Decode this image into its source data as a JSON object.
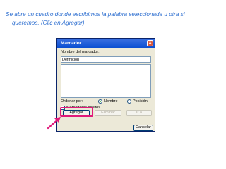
{
  "caption": {
    "line1": "Se abre un cuadro donde escribimos la palabra seleccionada u otra si",
    "line2": "queremos. (Clic en Agregar)"
  },
  "dialog": {
    "title": "Marcador",
    "close_glyph": "×",
    "name_label": "Nombre del marcador:",
    "name_value": "Definición",
    "sort_label": "Ordenar por:",
    "sort_options": [
      {
        "label": "Nombre",
        "selected": true
      },
      {
        "label": "Posición",
        "selected": false
      }
    ],
    "hidden_bookmarks_label": "Marcadores ocultos",
    "hidden_bookmarks_checked": false,
    "buttons": {
      "add": "Agregar",
      "delete": "Eliminar",
      "goto": "Ir a",
      "cancel": "Cancelar"
    }
  },
  "colors": {
    "caption": "#2e6fd0",
    "highlight": "#e0197a"
  }
}
